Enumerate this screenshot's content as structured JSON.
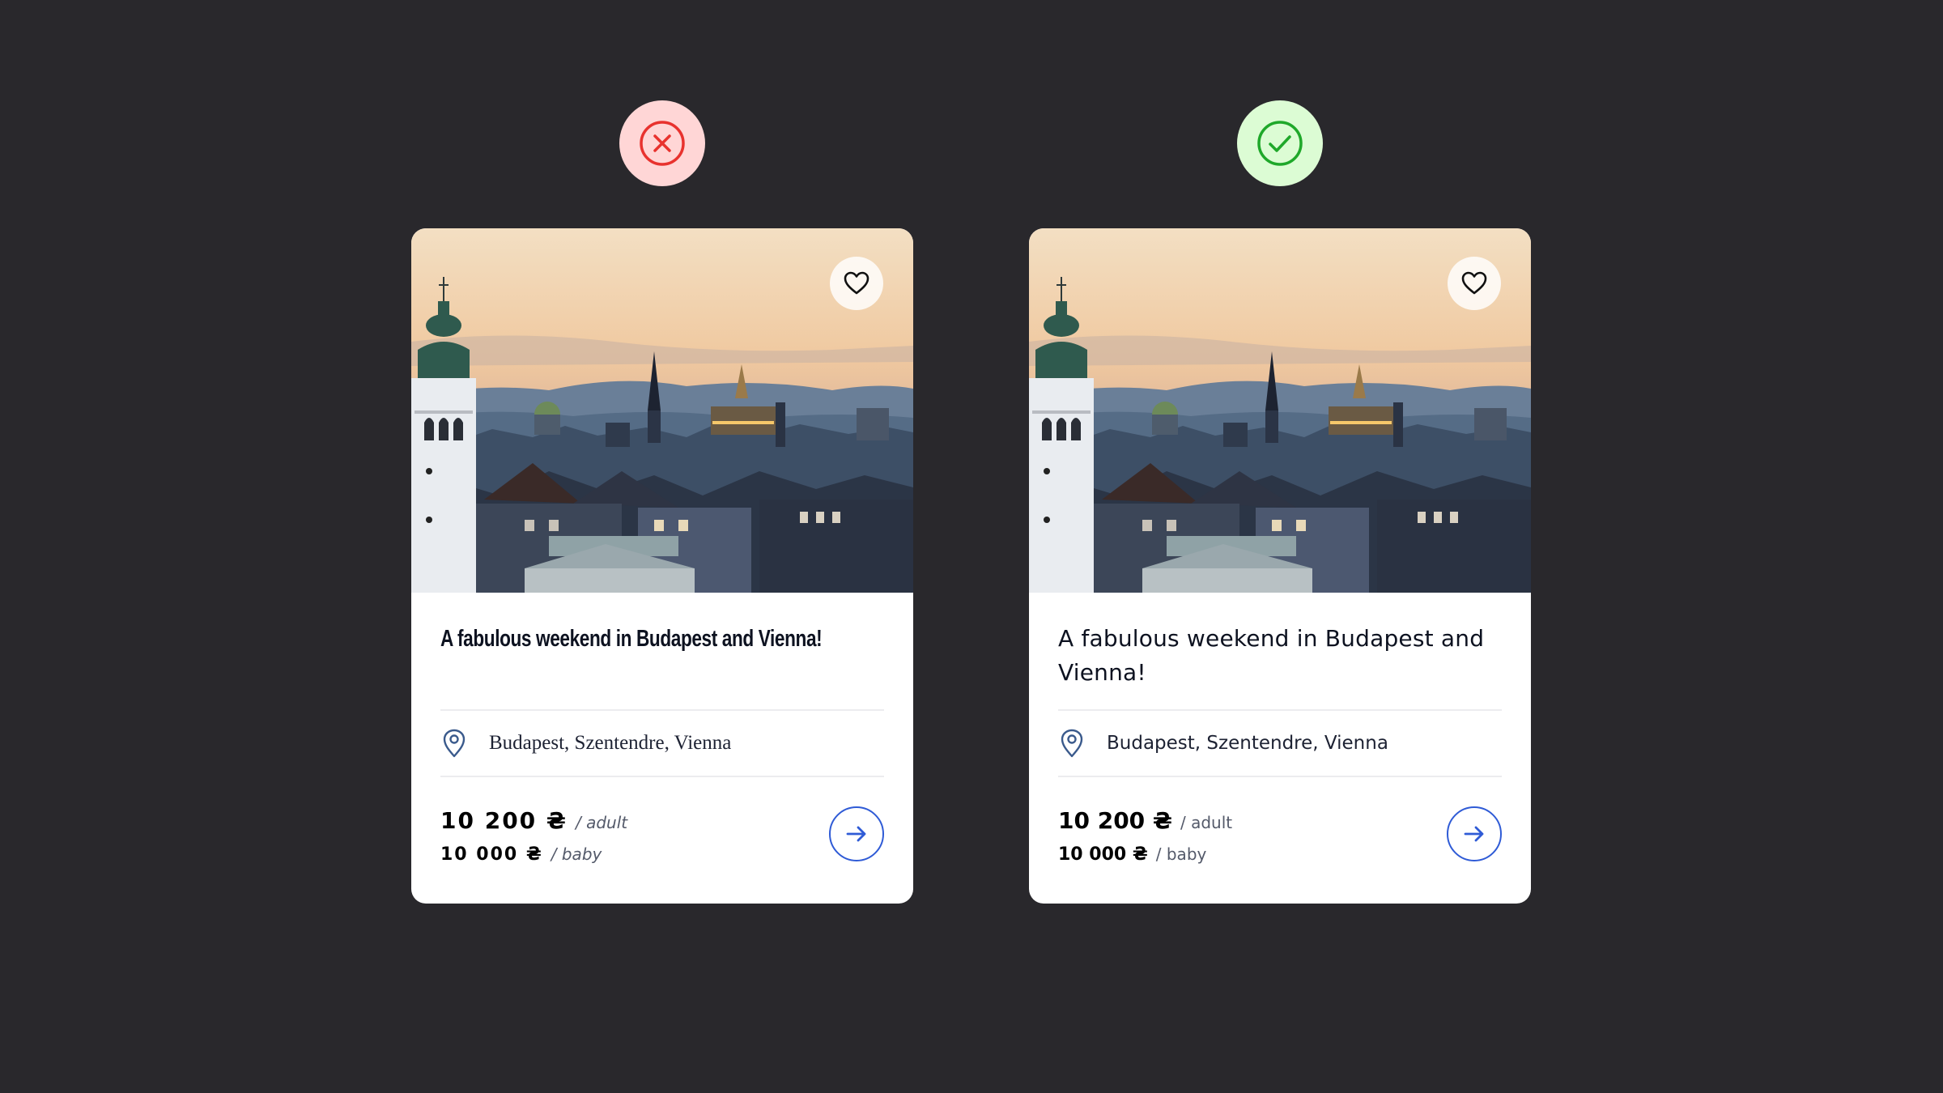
{
  "cards": [
    {
      "variant": "bad",
      "verdict_icon": "x-circle-icon",
      "verdict_color": "#e8322e",
      "title": "A fabulous weekend in Budapest and Vienna!",
      "location": "Budapest, Szentendre, Vienna",
      "price_adult": "10 200 ₴",
      "price_adult_unit": "/ adult",
      "price_baby": "10 000 ₴",
      "price_baby_unit": "/ baby"
    },
    {
      "variant": "good",
      "verdict_icon": "check-circle-icon",
      "verdict_color": "#1fa82a",
      "title": "A fabulous weekend in Budapest and Vienna!",
      "location": "Budapest, Szentendre, Vienna",
      "price_adult": "10 200 ₴",
      "price_adult_unit": "/ adult",
      "price_baby": "10 000 ₴",
      "price_baby_unit": "/ baby"
    }
  ],
  "accent_color": "#2f5bd6"
}
